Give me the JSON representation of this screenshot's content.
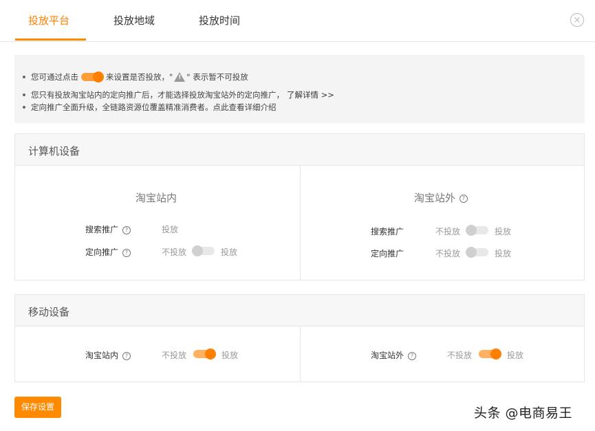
{
  "tabs": [
    {
      "label": "投放平台",
      "active": true
    },
    {
      "label": "投放地域",
      "active": false
    },
    {
      "label": "投放时间",
      "active": false
    }
  ],
  "close_icon": "×",
  "notice": {
    "line1_prefix": "您可通过点击",
    "line1_middle": "来设置是否投放，\"",
    "line1_suffix": "\" 表示暂不可投放",
    "line2": "您只有投放淘宝站内的定向推广后，才能选择投放淘宝站外的定向推广，",
    "line2_link": "了解详情 >>",
    "line3": "定向推广全面升级，全链路资源位覆盖精准消费者。点此查看详细介绍"
  },
  "computer": {
    "title": "计算机设备",
    "inside": {
      "title": "淘宝站内",
      "search_label": "搜索推广",
      "search_status": "投放",
      "targeted_label": "定向推广",
      "targeted_off": "不投放",
      "targeted_on": "投放",
      "targeted_enabled": false
    },
    "outside": {
      "title": "淘宝站外",
      "search_label": "搜索推广",
      "search_off": "不投放",
      "search_on": "投放",
      "search_enabled": false,
      "targeted_label": "定向推广",
      "targeted_off": "不投放",
      "targeted_on": "投放",
      "targeted_enabled": false
    }
  },
  "mobile": {
    "title": "移动设备",
    "inside": {
      "label": "淘宝站内",
      "off": "不投放",
      "on": "投放",
      "enabled": true
    },
    "outside": {
      "label": "淘宝站外",
      "off": "不投放",
      "on": "投放",
      "enabled": true
    }
  },
  "save_label": "保存设置",
  "watermark": "头条 @电商易王",
  "colors": {
    "accent": "#ff7f00",
    "toggle_on_track": "#ffb060",
    "toggle_off_track": "#e8e8e8"
  }
}
